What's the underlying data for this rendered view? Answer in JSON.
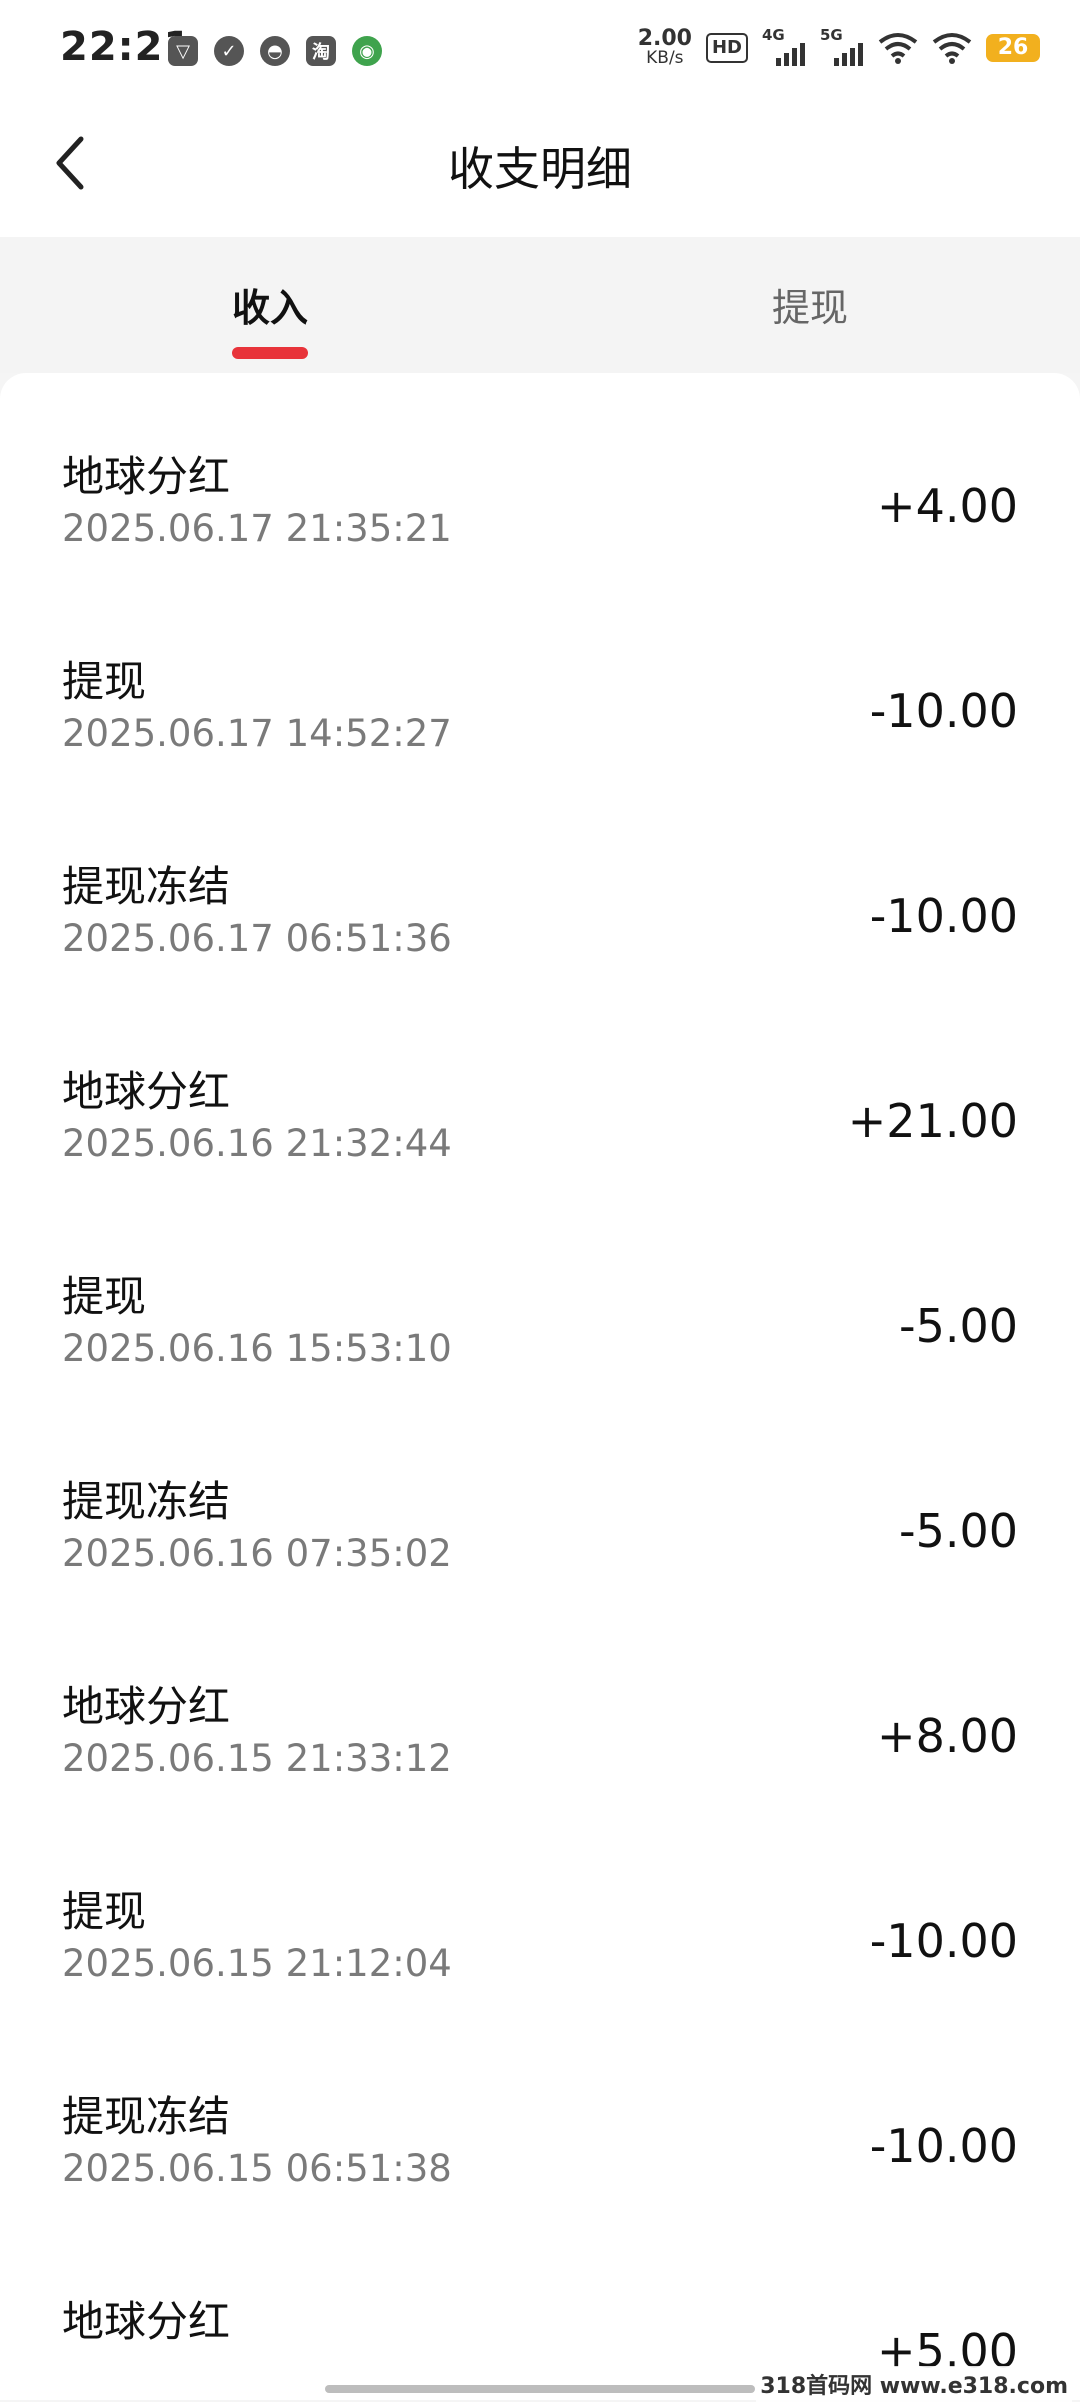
{
  "status_bar": {
    "time": "22:21",
    "net_speed_value": "2.00",
    "net_speed_unit": "KB/s",
    "hd_label": "HD",
    "sim1_label": "4G",
    "sim2_label": "5G",
    "battery": "26",
    "notification_icons": [
      "shield-app-icon",
      "vpn-app-icon",
      "qq-icon",
      "taobao-icon",
      "game-app-icon"
    ]
  },
  "header": {
    "title": "收支明细"
  },
  "tabs": [
    {
      "label": "收入",
      "active": true
    },
    {
      "label": "提现",
      "active": false
    }
  ],
  "transactions": [
    {
      "title": "地球分红",
      "time": "2025.06.17 21:35:21",
      "amount": "+4.00"
    },
    {
      "title": "提现",
      "time": "2025.06.17 14:52:27",
      "amount": "-10.00"
    },
    {
      "title": "提现冻结",
      "time": "2025.06.17 06:51:36",
      "amount": "-10.00"
    },
    {
      "title": "地球分红",
      "time": "2025.06.16 21:32:44",
      "amount": "+21.00"
    },
    {
      "title": "提现",
      "time": "2025.06.16 15:53:10",
      "amount": "-5.00"
    },
    {
      "title": "提现冻结",
      "time": "2025.06.16 07:35:02",
      "amount": "-5.00"
    },
    {
      "title": "地球分红",
      "time": "2025.06.15 21:33:12",
      "amount": "+8.00"
    },
    {
      "title": "提现",
      "time": "2025.06.15 21:12:04",
      "amount": "-10.00"
    },
    {
      "title": "提现冻结",
      "time": "2025.06.15 06:51:38",
      "amount": "-10.00"
    },
    {
      "title": "地球分红",
      "time": "",
      "amount": "+5.00"
    }
  ],
  "watermark": "318首码网 www.e318.com",
  "colors": {
    "accent": "#e8333a",
    "battery": "#f2b01e"
  }
}
